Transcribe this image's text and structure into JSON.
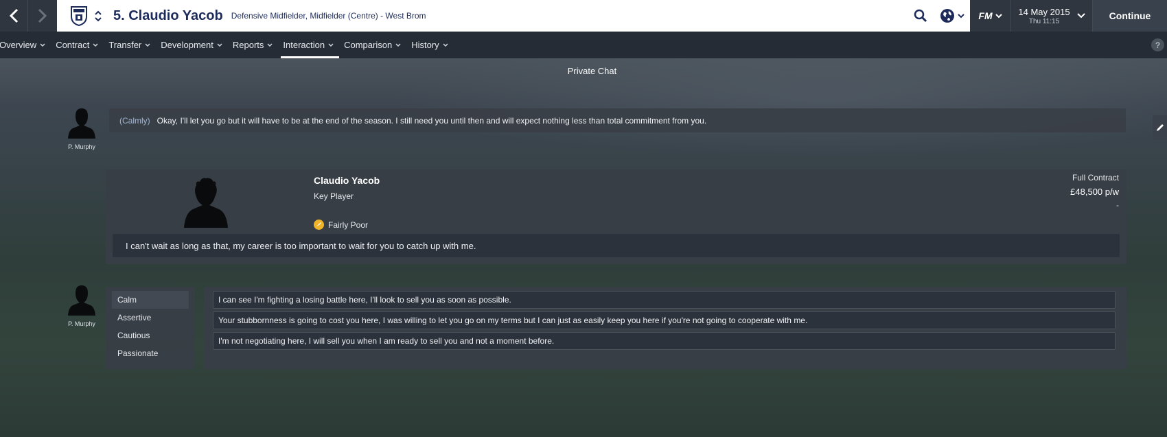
{
  "header": {
    "player_title": "5. Claudio Yacob",
    "player_position": "Defensive Midfielder, Midfielder (Centre) - West Brom",
    "fm_label": "FM",
    "date": "14 May 2015",
    "time": "Thu 11:15",
    "continue_label": "Continue"
  },
  "tabs": [
    {
      "label": "Overview"
    },
    {
      "label": "Contract"
    },
    {
      "label": "Transfer"
    },
    {
      "label": "Development"
    },
    {
      "label": "Reports"
    },
    {
      "label": "Interaction",
      "active": true
    },
    {
      "label": "Comparison"
    },
    {
      "label": "History"
    }
  ],
  "help_label": "?",
  "chat": {
    "section_title": "Private Chat",
    "manager_name": "P. Murphy",
    "manager_tone": "(Calmly)",
    "manager_message": "Okay, I'll let you go but it will have to be at the end of the season. I still need you until then and will expect nothing less than total commitment from you.",
    "player_card": {
      "name": "Claudio Yacob",
      "role": "Key Player",
      "morale": "Fairly Poor",
      "contract_type": "Full Contract",
      "wage": "£48,500 p/w",
      "extra": "-",
      "reply": "I can't wait as long as that, my career is too important to wait for you to catch up with me."
    },
    "tones": [
      "Calm",
      "Assertive",
      "Cautious",
      "Passionate"
    ],
    "selected_tone": "Calm",
    "options": [
      "I can see I'm fighting a losing battle here, I'll look to sell you as soon as possible.",
      "Your stubbornness is going to cost you here, I was willing to let you go on my terms but I can just as easily keep you here if you're not going to cooperate with me.",
      "I'm not negotiating here, I will sell you when I am ready to sell you and not a moment before."
    ]
  },
  "colors": {
    "header_title": "#1c2b5a",
    "morale_icon": "#f0b429",
    "tone_accent": "#9fb6d6"
  },
  "icons": [
    "back-arrow-icon",
    "forward-arrow-icon",
    "club-crest-icon",
    "search-icon",
    "globe-icon",
    "chevron-down-icon",
    "edit-icon"
  ]
}
